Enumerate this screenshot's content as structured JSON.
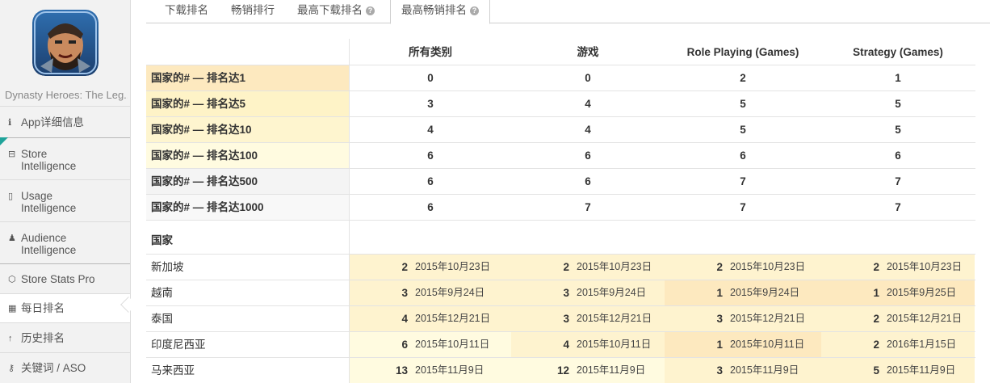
{
  "app": {
    "name": "Dynasty Heroes: The Leg..."
  },
  "sidebar": {
    "items": [
      {
        "icon": "info-icon",
        "glyph": "ℹ",
        "label": "App详细信息"
      },
      {
        "icon": "store-icon",
        "glyph": "⊟",
        "label": "Store Intelligence"
      },
      {
        "icon": "phone-icon",
        "glyph": "▯",
        "label": "Usage Intelligence"
      },
      {
        "icon": "person-icon",
        "glyph": "♟",
        "label": "Audience Intelligence"
      },
      {
        "icon": "stats-icon",
        "glyph": "⬡",
        "label": "Store Stats Pro"
      },
      {
        "icon": "calendar-icon",
        "glyph": "▦",
        "label": "每日排名"
      },
      {
        "icon": "arrow-up-icon",
        "glyph": "↑",
        "label": "历史排名"
      },
      {
        "icon": "key-icon",
        "glyph": "⚷",
        "label": "关键词 / ASO"
      }
    ]
  },
  "tabs": [
    {
      "label": "下载排名",
      "help": false
    },
    {
      "label": "畅销排行",
      "help": false
    },
    {
      "label": "最高下载排名",
      "help": true
    },
    {
      "label": "最高畅销排名",
      "help": true
    }
  ],
  "columns": [
    "所有类别",
    "游戏",
    "Role Playing (Games)",
    "Strategy (Games)"
  ],
  "rank_rows": [
    {
      "label": "国家的# — 排名达1",
      "values": [
        "0",
        "0",
        "2",
        "1"
      ]
    },
    {
      "label": "国家的# — 排名达5",
      "values": [
        "3",
        "4",
        "5",
        "5"
      ]
    },
    {
      "label": "国家的# — 排名达10",
      "values": [
        "4",
        "4",
        "5",
        "5"
      ]
    },
    {
      "label": "国家的# — 排名达100",
      "values": [
        "6",
        "6",
        "6",
        "6"
      ]
    },
    {
      "label": "国家的# — 排名达500",
      "values": [
        "6",
        "6",
        "7",
        "7"
      ]
    },
    {
      "label": "国家的# — 排名达1000",
      "values": [
        "6",
        "7",
        "7",
        "7"
      ]
    }
  ],
  "country_header": "国家",
  "countries": [
    {
      "name": "新加坡",
      "cells": [
        {
          "rank": "2",
          "date": "2015年10月23日"
        },
        {
          "rank": "2",
          "date": "2015年10月23日"
        },
        {
          "rank": "2",
          "date": "2015年10月23日"
        },
        {
          "rank": "2",
          "date": "2015年10月23日"
        }
      ]
    },
    {
      "name": "越南",
      "cells": [
        {
          "rank": "3",
          "date": "2015年9月24日"
        },
        {
          "rank": "3",
          "date": "2015年9月24日"
        },
        {
          "rank": "1",
          "date": "2015年9月24日"
        },
        {
          "rank": "1",
          "date": "2015年9月25日"
        }
      ]
    },
    {
      "name": "泰国",
      "cells": [
        {
          "rank": "4",
          "date": "2015年12月21日"
        },
        {
          "rank": "3",
          "date": "2015年12月21日"
        },
        {
          "rank": "3",
          "date": "2015年12月21日"
        },
        {
          "rank": "2",
          "date": "2015年12月21日"
        }
      ]
    },
    {
      "name": "印度尼西亚",
      "cells": [
        {
          "rank": "6",
          "date": "2015年10月11日"
        },
        {
          "rank": "4",
          "date": "2015年10月11日"
        },
        {
          "rank": "1",
          "date": "2015年10月11日"
        },
        {
          "rank": "2",
          "date": "2016年1月15日"
        }
      ]
    },
    {
      "name": "马来西亚",
      "cells": [
        {
          "rank": "13",
          "date": "2015年11月9日"
        },
        {
          "rank": "12",
          "date": "2015年11月9日"
        },
        {
          "rank": "3",
          "date": "2015年11月9日"
        },
        {
          "rank": "5",
          "date": "2015年11月9日"
        }
      ]
    }
  ],
  "colors": {
    "rank1_bg": "#fde9bf",
    "rank5_bg": "#fef3c7",
    "rank10_bg": "#fef5cf",
    "rank100_bg": "#fffbe0",
    "rank500_bg": "#f4f4f4",
    "rank1000_bg": "#f8f8f8",
    "cell_top_bg": "#fde9bf",
    "cell_high_bg": "#fef3cf",
    "cell_mid_bg": "#fffbe0",
    "accent_teal": "#1fa39a"
  }
}
